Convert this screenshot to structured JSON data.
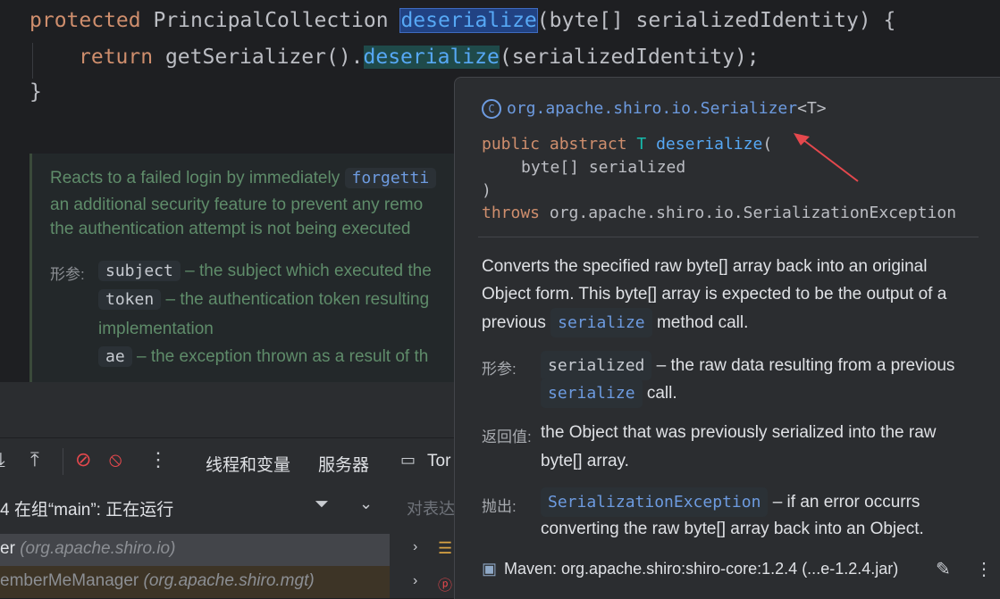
{
  "editor": {
    "line1": {
      "keyword": "protected",
      "type": "PrincipalCollection",
      "method": "deserialize",
      "params": "(byte[] serializedIdentity) {"
    },
    "line2": {
      "keyword": "return",
      "call": "getSerializer().",
      "method": "deserialize",
      "rest": "(serializedIdentity);"
    },
    "line3": "}",
    "javadoc": {
      "line1_prefix": "Reacts to a failed login by immediately",
      "line1_chip": "forgetti",
      "line2": "an additional security feature to prevent any remo",
      "line3": "the authentication attempt is not being executed",
      "params_label": "形参:",
      "param1_name": "subject",
      "param1_desc": "– the subject which executed the",
      "param2_name": "token",
      "param2_desc": "– the authentication token resulting",
      "param2_cont": "implementation",
      "param3_name": "ae",
      "param3_desc": "– the exception thrown as a result of th"
    }
  },
  "debug": {
    "tabs": [
      "线程和变量",
      "服务器",
      "Tor"
    ],
    "thread_status": "4 在组“main”: 正在运行",
    "filter_placeholder": "对表达",
    "frames": [
      {
        "name": "er",
        "pkg": "(org.apache.shiro.io)"
      },
      {
        "name": "emberMeManager",
        "pkg": "(org.apache.shiro.mgt)"
      }
    ]
  },
  "popup": {
    "class_ref": "org.apache.shiro.io.Serializer",
    "class_generic": "<T>",
    "sig_modifiers": "public abstract",
    "sig_type": "T",
    "sig_method": "deserialize",
    "sig_open": "(",
    "sig_param": "byte[] serialized",
    "sig_close": ")",
    "sig_throws_kw": "throws",
    "sig_throws": "org.apache.shiro.io.SerializationException",
    "desc_line1": "Converts the specified raw byte[] array back into an original",
    "desc_line2": "Object form. This byte[] array is expected to be the output of a",
    "desc_line3_pre": "previous",
    "desc_line3_chip": "serialize",
    "desc_line3_post": "method call.",
    "params_label": "形参:",
    "param_name": "serialized",
    "param_desc": "– the raw data resulting from a previous",
    "param_chip2": "serialize",
    "param_desc2": "call.",
    "returns_label": "返回值:",
    "returns_line1": "the Object that was previously serialized into the raw",
    "returns_line2": "byte[] array.",
    "throws_label": "抛出:",
    "throws_chip": "SerializationException",
    "throws_desc1": "– if an error occurrs",
    "throws_desc2": "converting the raw byte[] array back into an Object.",
    "footer": "Maven: org.apache.shiro:shiro-core:1.2.4 (...e-1.2.4.jar)"
  },
  "colors": {
    "editor_bg": "#1e1f22",
    "popup_bg": "#2b2d30",
    "keyword": "#cf8e6d",
    "method": "#56a8f5",
    "arrow": "#e5484d"
  }
}
